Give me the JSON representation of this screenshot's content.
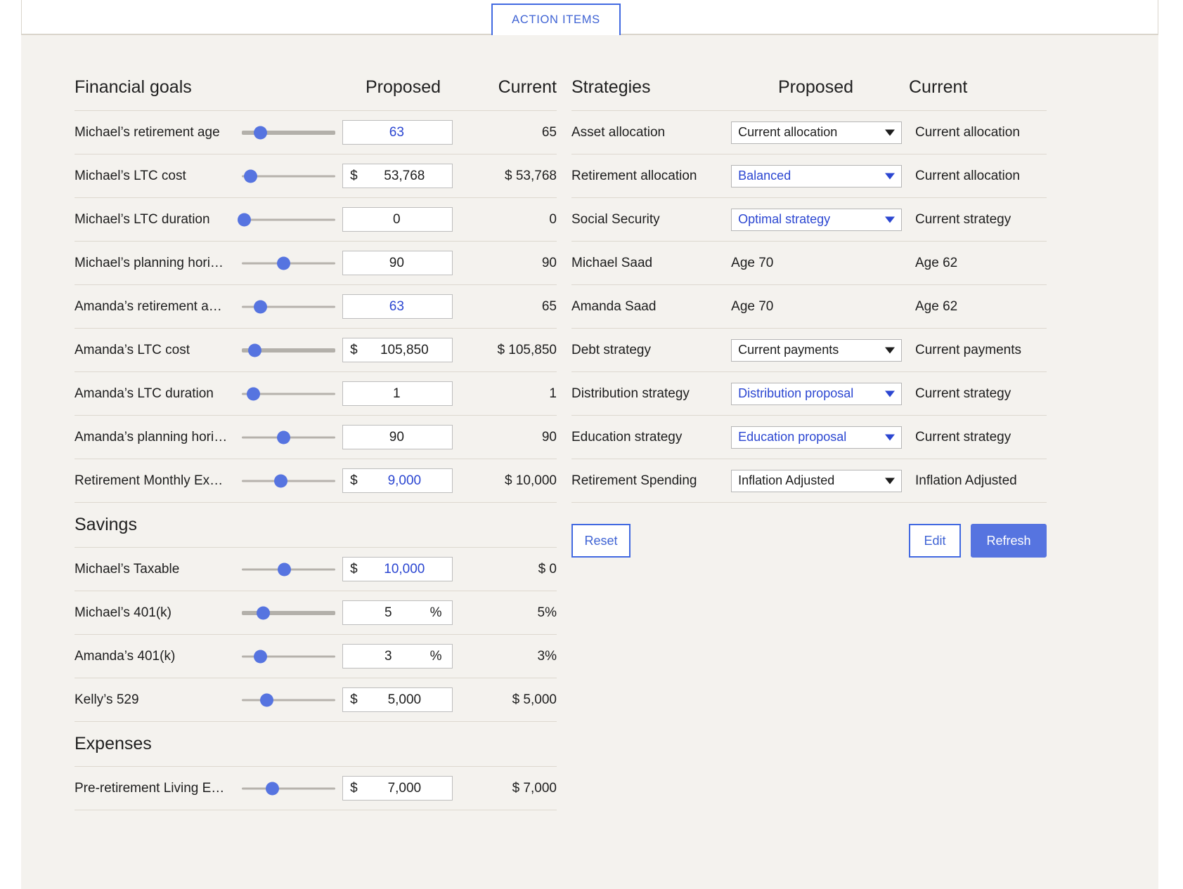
{
  "topbar": {
    "action_items_tab": "ACTION ITEMS"
  },
  "left_panel": {
    "header": {
      "title": "Financial goals",
      "proposed": "Proposed",
      "current": "Current"
    },
    "goals": [
      {
        "label": "Michael’s retirement age",
        "prefix": "",
        "suffix": "",
        "value": "63",
        "blue": true,
        "current": "65",
        "thumb": 20,
        "thick": true
      },
      {
        "label": "Michael’s LTC cost",
        "prefix": "$",
        "suffix": "",
        "value": "53,768",
        "blue": false,
        "current": "$ 53,768",
        "thumb": 10,
        "thick": false
      },
      {
        "label": "Michael’s LTC duration",
        "prefix": "",
        "suffix": "",
        "value": "0",
        "blue": false,
        "current": "0",
        "thumb": 3,
        "thick": false
      },
      {
        "label": "Michael’s planning hori…",
        "prefix": "",
        "suffix": "",
        "value": "90",
        "blue": false,
        "current": "90",
        "thumb": 45,
        "thick": false
      },
      {
        "label": "Amanda’s retirement a…",
        "prefix": "",
        "suffix": "",
        "value": "63",
        "blue": true,
        "current": "65",
        "thumb": 20,
        "thick": false
      },
      {
        "label": "Amanda’s LTC cost",
        "prefix": "$",
        "suffix": "",
        "value": "105,850",
        "blue": false,
        "current": "$ 105,850",
        "thumb": 14,
        "thick": true
      },
      {
        "label": "Amanda’s LTC duration",
        "prefix": "",
        "suffix": "",
        "value": "1",
        "blue": false,
        "current": "1",
        "thumb": 13,
        "thick": false
      },
      {
        "label": "Amanda’s planning hori…",
        "prefix": "",
        "suffix": "",
        "value": "90",
        "blue": false,
        "current": "90",
        "thumb": 45,
        "thick": false
      },
      {
        "label": "Retirement Monthly Ex…",
        "prefix": "$",
        "suffix": "",
        "value": "9,000",
        "blue": true,
        "current": "$ 10,000",
        "thumb": 42,
        "thick": false
      }
    ],
    "savings_heading": "Savings",
    "savings": [
      {
        "label": "Michael’s Taxable",
        "prefix": "$",
        "suffix": "",
        "value": "10,000",
        "blue": true,
        "current": "$ 0",
        "thumb": 46,
        "thick": false
      },
      {
        "label": "Michael’s 401(k)",
        "prefix": "",
        "suffix": "%",
        "value": "5",
        "blue": false,
        "current": "5%",
        "thumb": 23,
        "thick": true
      },
      {
        "label": "Amanda’s 401(k)",
        "prefix": "",
        "suffix": "%",
        "value": "3",
        "blue": false,
        "current": "3%",
        "thumb": 20,
        "thick": false
      },
      {
        "label": "Kelly’s 529",
        "prefix": "$",
        "suffix": "",
        "value": "5,000",
        "blue": false,
        "current": "$ 5,000",
        "thumb": 27,
        "thick": false
      }
    ],
    "expenses_heading": "Expenses",
    "expenses": [
      {
        "label": "Pre-retirement Living E…",
        "prefix": "$",
        "suffix": "",
        "value": "7,000",
        "blue": false,
        "current": "$ 7,000",
        "thumb": 33,
        "thick": false
      }
    ]
  },
  "right_panel": {
    "header": {
      "title": "Strategies",
      "proposed": "Proposed",
      "current": "Current"
    },
    "strategies": [
      {
        "label": "Asset allocation",
        "type": "select",
        "proposed": "Current allocation",
        "blue": false,
        "current": "Current allocation"
      },
      {
        "label": "Retirement allocation",
        "type": "select",
        "proposed": "Balanced",
        "blue": true,
        "current": "Current allocation"
      },
      {
        "label": "Social Security",
        "type": "select",
        "proposed": "Optimal strategy",
        "blue": true,
        "current": "Current strategy"
      },
      {
        "label": "Michael Saad",
        "type": "text",
        "proposed": "Age 70",
        "blue": false,
        "current": "Age 62"
      },
      {
        "label": "Amanda Saad",
        "type": "text",
        "proposed": "Age 70",
        "blue": false,
        "current": "Age 62"
      },
      {
        "label": "Debt strategy",
        "type": "select",
        "proposed": "Current payments",
        "blue": false,
        "current": "Current payments"
      },
      {
        "label": "Distribution strategy",
        "type": "select",
        "proposed": "Distribution proposal",
        "blue": true,
        "current": "Current strategy"
      },
      {
        "label": "Education strategy",
        "type": "select",
        "proposed": "Education proposal",
        "blue": true,
        "current": "Current strategy"
      },
      {
        "label": "Retirement Spending",
        "type": "select",
        "proposed": "Inflation Adjusted",
        "blue": false,
        "current": "Inflation Adjusted"
      }
    ],
    "buttons": {
      "reset": "Reset",
      "edit": "Edit",
      "refresh": "Refresh"
    }
  },
  "colors": {
    "accent_blue": "#4169e1",
    "value_blue": "#2b46d1",
    "thumb_blue": "#5674e0",
    "surface": "#f4f2ee",
    "divider": "#ddd8cf"
  }
}
